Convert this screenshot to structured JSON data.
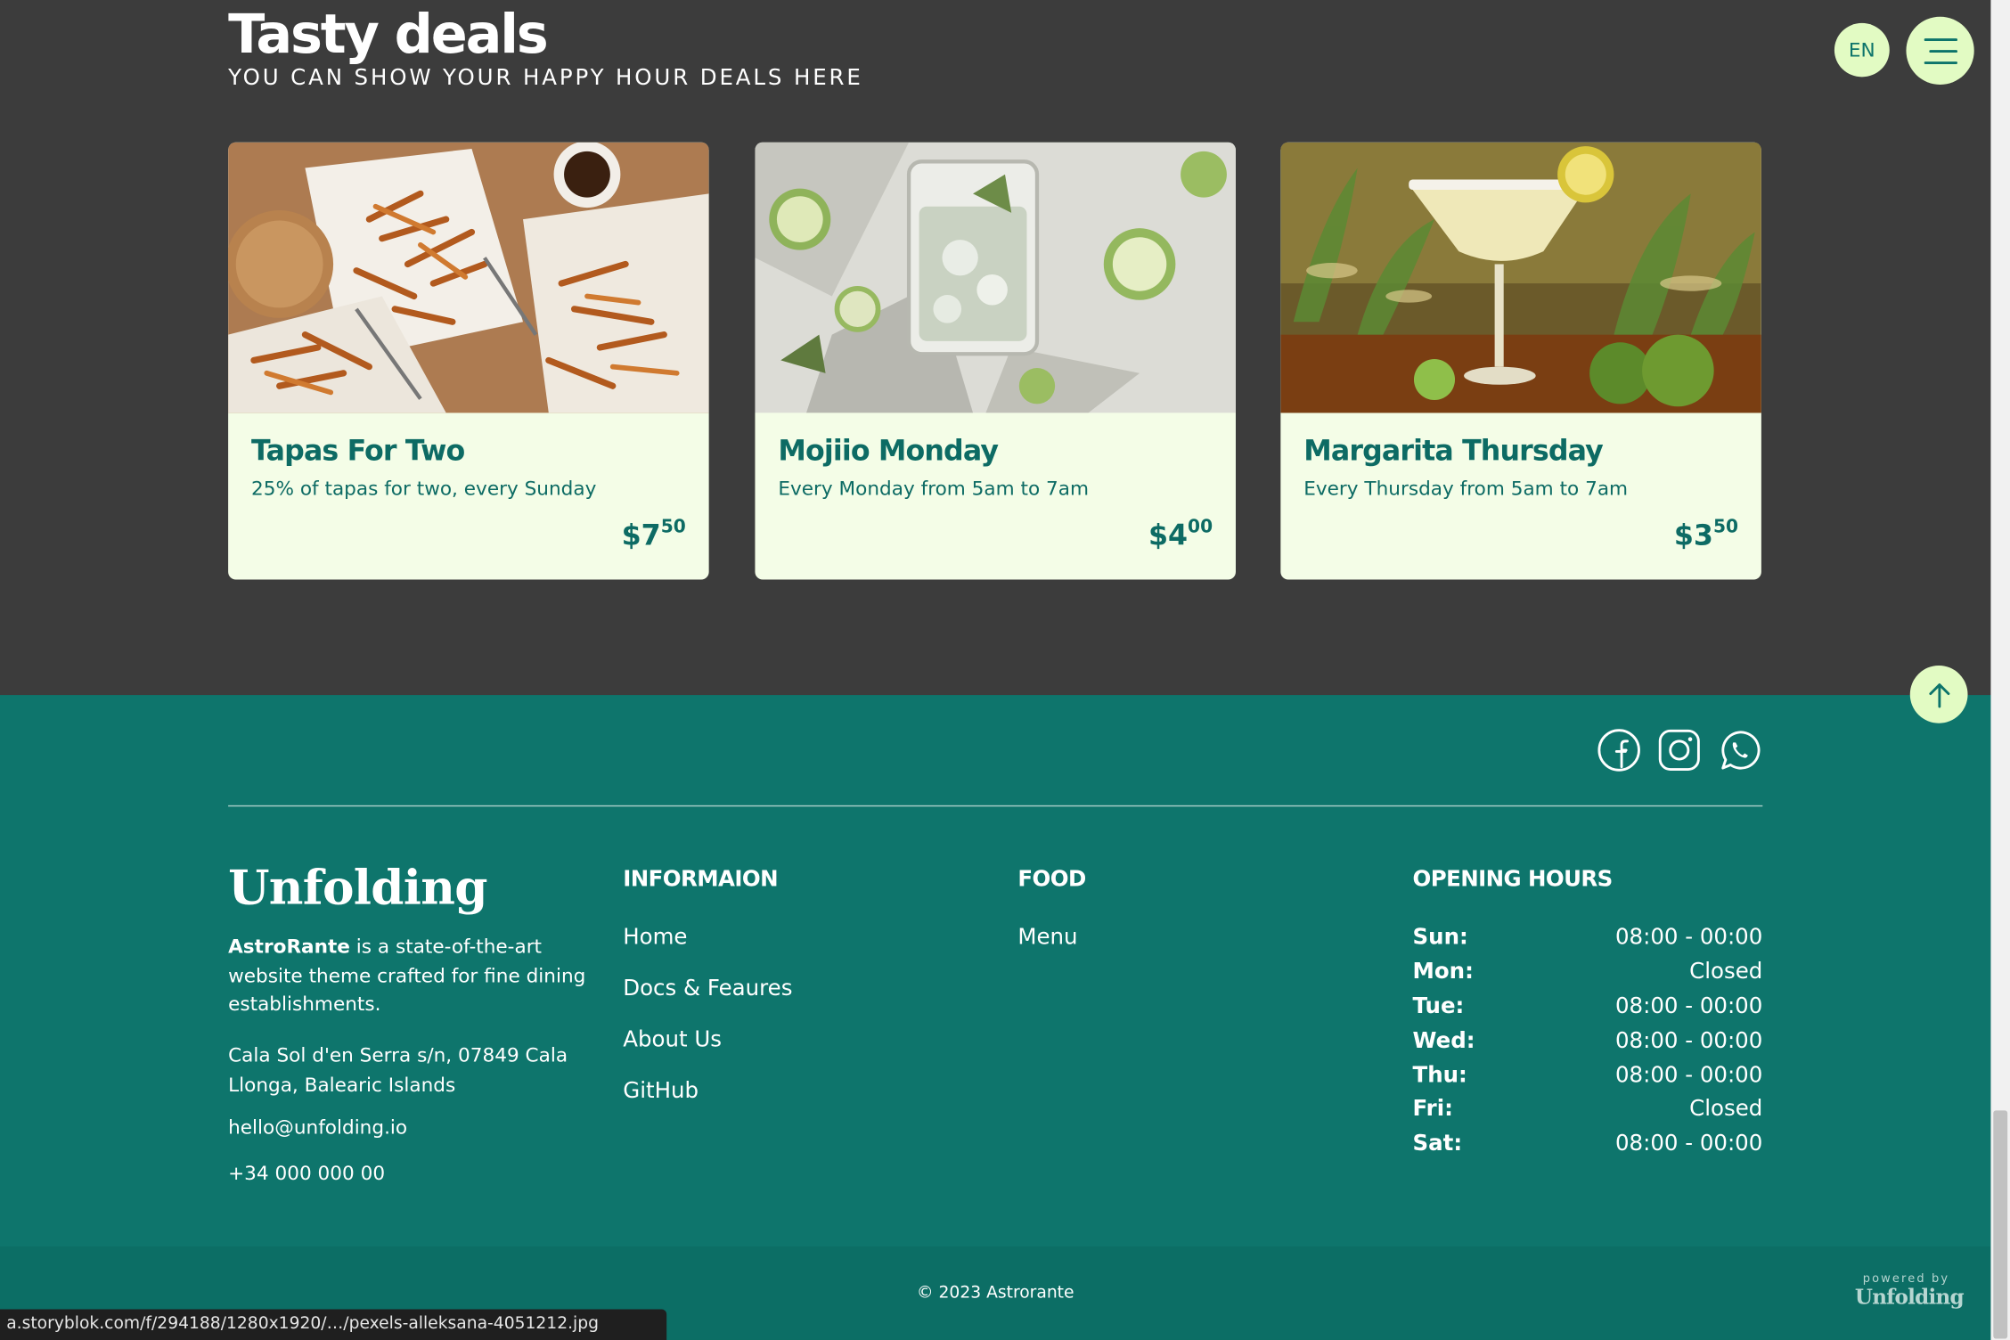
{
  "header": {
    "title": "Tasty deals",
    "subtitle": "YOU CAN SHOW YOUR HAPPY HOUR DEALS HERE",
    "language": "EN",
    "menu_icon": "hamburger-icon"
  },
  "deals": [
    {
      "name": "Tapas For Two",
      "description": "25% of tapas for two, every Sunday",
      "price_main": "$7",
      "price_cents": "50"
    },
    {
      "name": "Mojiio Monday",
      "description": "Every Monday from 5am to 7am",
      "price_main": "$4",
      "price_cents": "00"
    },
    {
      "name": "Margarita Thursday",
      "description": "Every Thursday from 5am to 7am",
      "price_main": "$3",
      "price_cents": "50"
    }
  ],
  "footer": {
    "social_icons": [
      "facebook-icon",
      "instagram-icon",
      "whatsapp-icon"
    ],
    "logo": "Unfolding",
    "about_brand": "AstroRante",
    "about_text": " is a state-of-the-art website theme crafted for fine dining establishments.",
    "address": "Cala Sol d'en Serra s/n, 07849 Cala Llonga, Balearic Islands",
    "email": "hello@unfolding.io",
    "phone": "+34 000 000 00",
    "information": {
      "heading": "INFORMAION",
      "links": [
        "Home",
        "Docs & Feaures",
        "About Us",
        "GitHub"
      ]
    },
    "food": {
      "heading": "FOOD",
      "links": [
        "Menu"
      ]
    },
    "opening_hours": {
      "heading": "OPENING HOURS",
      "rows": [
        {
          "day": "Sun:",
          "hours": "08:00 - 00:00"
        },
        {
          "day": "Mon:",
          "hours": "Closed"
        },
        {
          "day": "Tue:",
          "hours": "08:00 - 00:00"
        },
        {
          "day": "Wed:",
          "hours": "08:00 - 00:00"
        },
        {
          "day": "Thu:",
          "hours": "08:00 - 00:00"
        },
        {
          "day": "Fri:",
          "hours": "Closed"
        },
        {
          "day": "Sat:",
          "hours": "08:00 - 00:00"
        }
      ]
    },
    "copyright": "© 2023 Astrorante",
    "powered_by": "powered by",
    "powered_logo": "Unfolding"
  },
  "status_bar": {
    "url": "a.storyblok.com/f/294188/1280x1920/…/pexels-alleksana-4051212.jpg"
  },
  "colors": {
    "deals_background": "#3c3c3c",
    "footer_background": "#0e756c",
    "accent": "#e2fbc3",
    "card_background": "#f4fde7",
    "card_text": "#0d6b64"
  }
}
